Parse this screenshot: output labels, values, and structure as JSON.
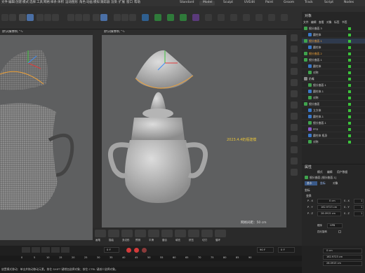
{
  "menu": [
    "文件",
    "编辑",
    "创建",
    "模式",
    "选择",
    "工具",
    "网格",
    "样条",
    "体积",
    "运动图形",
    "角色",
    "动画",
    "模拟",
    "跟踪器",
    "渲染",
    "扩展",
    "窗口",
    "帮助"
  ],
  "layouts": [
    "Standard",
    "Model",
    "Sculpt",
    "UVEdit",
    "Paint",
    "Groom",
    "Track",
    "Script",
    "Nodes"
  ],
  "viewport_left": {
    "title": "默认摄像机 °∿"
  },
  "viewport_right": {
    "title": "默认摄像机 °∿",
    "watermark": "2023.4.4奶瓶建模",
    "grid_label": "网格间距：50 cm"
  },
  "objects_header": {
    "title": "对象",
    "menu": [
      "文件",
      "编辑",
      "查看",
      "对象",
      "标签",
      "书签"
    ]
  },
  "objects": [
    {
      "name": "细分曲面.3",
      "indent": 0
    },
    {
      "name": "圆柱体",
      "indent": 1
    },
    {
      "name": "细分曲面.1",
      "indent": 0
    },
    {
      "name": "圆柱体",
      "indent": 1
    },
    {
      "name": "细分曲面.2",
      "indent": 0
    },
    {
      "name": "细分曲面.1",
      "indent": 0
    },
    {
      "name": "圆柱体",
      "indent": 1
    },
    {
      "name": "对称",
      "indent": 1
    },
    {
      "name": "奶嘴",
      "indent": 0
    },
    {
      "name": "细分曲面.1",
      "indent": 1
    },
    {
      "name": "圆柱体.1",
      "indent": 1
    },
    {
      "name": "对称",
      "indent": 1
    },
    {
      "name": "细分曲面",
      "indent": 0
    },
    {
      "name": "立方体",
      "indent": 1
    },
    {
      "name": "圆柱体.1",
      "indent": 1
    },
    {
      "name": "细分曲面.1",
      "indent": 1
    },
    {
      "name": "FFD",
      "indent": 1
    },
    {
      "name": "圆柱体 瓶身",
      "indent": 1
    },
    {
      "name": "对称",
      "indent": 1
    }
  ],
  "attributes": {
    "title": "属性",
    "menu": [
      "模式",
      "编辑",
      "用户数据"
    ],
    "object_label": "细分曲面 [细分曲面.1]",
    "tabs": [
      "基本",
      "坐标",
      "对象"
    ],
    "section": "坐标",
    "subsection": "变换",
    "rows": [
      {
        "label": "P . X",
        "value": "0 cm",
        "r_label": "S . X",
        "r_value": "1"
      },
      {
        "label": "P . Y",
        "value": "162.9723 cm",
        "r_label": "S . Y",
        "r_value": "1"
      },
      {
        "label": "P . Z",
        "value": "28.0915 cm",
        "r_label": "S . Z",
        "r_value": "1"
      }
    ],
    "order_label": "顺序",
    "order_value": "HPB",
    "four_label": "四元旋转",
    "bottom_values": [
      "0 cm",
      "162.9723 cm",
      "28.0915 cm"
    ]
  },
  "timeline": {
    "start": "0 F",
    "end": "90 F",
    "current": "0 F",
    "ticks": [
      "0",
      "5",
      "10",
      "15",
      "20",
      "25",
      "30",
      "35",
      "40",
      "45",
      "50",
      "55",
      "60",
      "65",
      "70",
      "75",
      "80",
      "85",
      "90"
    ]
  },
  "bottom_tools": [
    "画笔",
    "描绘",
    "多边形",
    "预测",
    "平滑",
    "缝合",
    "填充",
    "挤压",
    "切刀",
    "循环"
  ],
  "status_text": "放置模式移动：单击并拖动移动元素。按住 SHIFT 键增加选择对象；按住 CTRL 键减少选择对象。",
  "colors": {
    "accent": "#3e8ef7",
    "check": "#3cc43c",
    "orange": "#f0a33a",
    "watermark": "#e6c23a"
  }
}
